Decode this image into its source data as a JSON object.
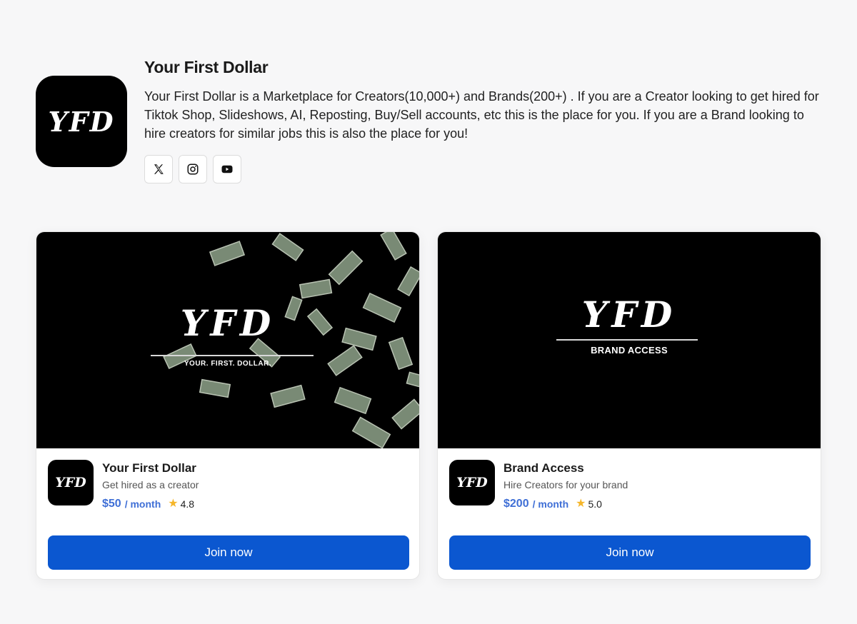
{
  "header": {
    "logo_text": "YFD",
    "title": "Your First Dollar",
    "description": "Your First Dollar is a Marketplace for Creators(10,000+) and Brands(200+) . If you are a Creator looking to get hired for Tiktok Shop, Slideshows, AI, Reposting, Buy/Sell accounts, etc this is the place for you. If you are a Brand looking to hire creators for similar jobs this is also the place for you!",
    "socials": [
      {
        "icon": "x-icon"
      },
      {
        "icon": "instagram-icon"
      },
      {
        "icon": "youtube-icon"
      }
    ]
  },
  "products": [
    {
      "banner": {
        "mono": "YFD",
        "sub": "YOUR. FIRST. DOLLAR."
      },
      "thumb_text": "YFD",
      "name": "Your First Dollar",
      "tagline": "Get hired as a creator",
      "price": "$50",
      "period": "/ month",
      "rating": "4.8",
      "cta": "Join now"
    },
    {
      "banner": {
        "mono": "YFD",
        "sub": "BRAND ACCESS"
      },
      "thumb_text": "YFD",
      "name": "Brand Access",
      "tagline": "Hire Creators for your brand",
      "price": "$200",
      "period": "/ month",
      "rating": "5.0",
      "cta": "Join now"
    }
  ],
  "colors": {
    "accent": "#0b57d0",
    "price": "#3f6fd6",
    "star": "#f5b62a",
    "background": "#f7f7f8"
  }
}
